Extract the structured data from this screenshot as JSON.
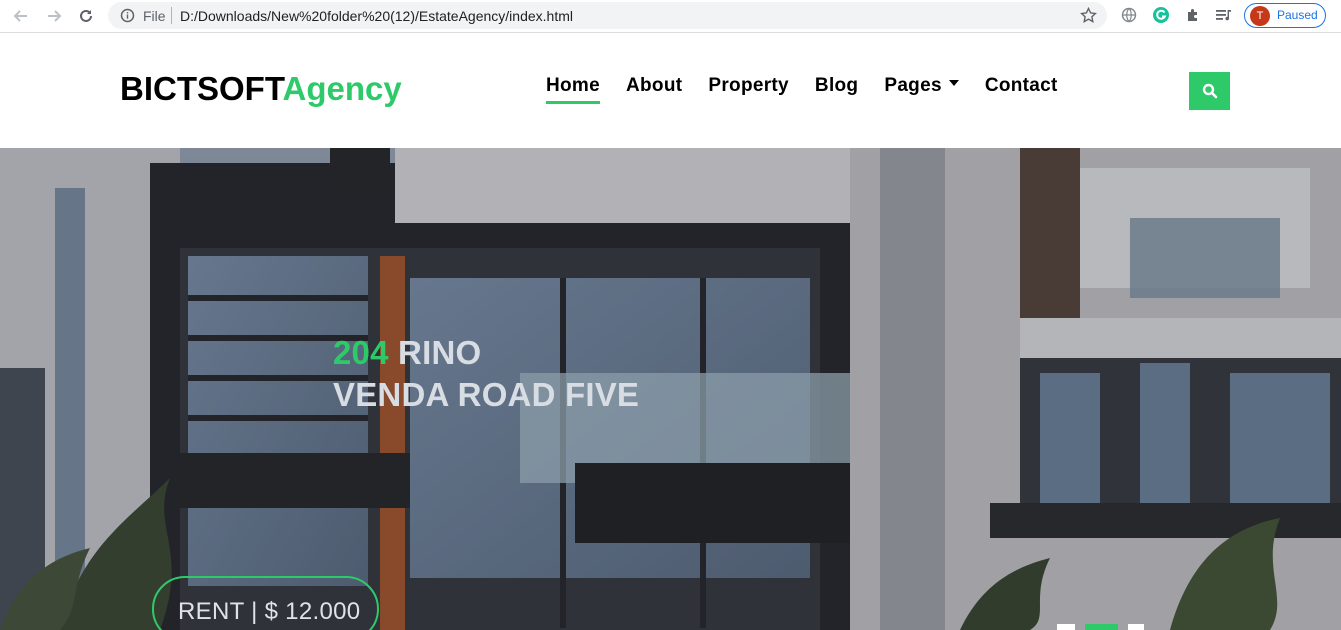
{
  "browser": {
    "scheme_label": "File",
    "url": "D:/Downloads/New%20folder%20(12)/EstateAgency/index.html",
    "profile_initial": "T",
    "profile_status": "Paused"
  },
  "header": {
    "brand_primary": "BICTSOFT",
    "brand_accent": "Agency",
    "nav": [
      {
        "label": "Home",
        "active": true
      },
      {
        "label": "About"
      },
      {
        "label": "Property"
      },
      {
        "label": "Blog"
      },
      {
        "label": "Pages",
        "dropdown": true
      },
      {
        "label": "Contact"
      }
    ]
  },
  "hero": {
    "title_number": "204",
    "title_line1_rest": " RINO",
    "title_line2": "VENDA ROAD FIVE",
    "price_label": "RENT | $ 12.000"
  },
  "colors": {
    "accent": "#2eca6a",
    "text_dark": "#000000"
  },
  "icons": [
    "back-icon",
    "forward-icon",
    "reload-icon",
    "info-icon",
    "star-icon",
    "globe-icon",
    "grammarly-icon",
    "extensions-icon",
    "reading-list-icon",
    "search-icon",
    "caret-down-icon"
  ]
}
